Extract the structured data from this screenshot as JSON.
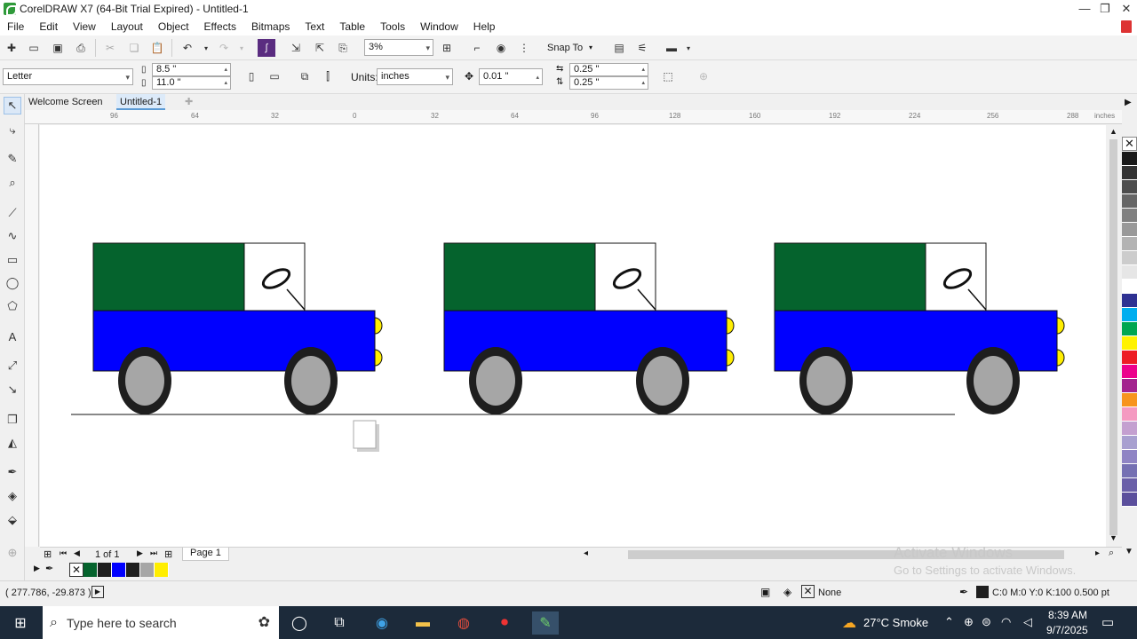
{
  "window": {
    "title": "CorelDRAW X7 (64-Bit Trial Expired) - Untitled-1",
    "minimize": "—",
    "restore": "❐",
    "close": "✕"
  },
  "menu": [
    "File",
    "Edit",
    "View",
    "Layout",
    "Object",
    "Effects",
    "Bitmaps",
    "Text",
    "Table",
    "Tools",
    "Window",
    "Help"
  ],
  "toolbar": {
    "zoom": "3%",
    "snap_to": "Snap To"
  },
  "property_bar": {
    "page_size": "Letter",
    "width": "8.5 \"",
    "height": "11.0 \"",
    "units_label": "Units:",
    "units": "inches",
    "nudge": "0.01 \"",
    "dup_x": "0.25 \"",
    "dup_y": "0.25 \""
  },
  "tabs": [
    "Welcome Screen",
    "Untitled-1"
  ],
  "ruler": {
    "ticks": [
      "96",
      "64",
      "32",
      "0",
      "32",
      "64",
      "96",
      "128",
      "160",
      "192",
      "224",
      "256",
      "288"
    ],
    "unit": "inches"
  },
  "drawing": {
    "trucks": 3,
    "cab_color": "#05632d",
    "body_color": "#0000ff",
    "light_color": "#ffee00",
    "wheel_rim": "#1e1e1e",
    "hub_color": "#a6a6a6"
  },
  "page_nav": {
    "counter": "1 of 1",
    "page_tab": "Page 1"
  },
  "document_palette": [
    "#05632d",
    "#1e1e1e",
    "#0000ff",
    "#1e1e1e",
    "#a6a6a6",
    "#ffee00"
  ],
  "palette": [
    "#1a1a1a",
    "#333333",
    "#4d4d4d",
    "#666666",
    "#808080",
    "#999999",
    "#b3b3b3",
    "#cccccc",
    "#e6e6e6",
    "#ffffff",
    "#2e3192",
    "#00aeef",
    "#00a651",
    "#fff200",
    "#ed1c24",
    "#ec008c",
    "#a3238e",
    "#f7941d",
    "#f49ac1",
    "#c4a0d0",
    "#a8a0d0",
    "#8f84c4",
    "#7570b3",
    "#6a5fa8",
    "#5b4f9c"
  ],
  "status": {
    "coords": "( 277.786, -29.873 )",
    "fill": "None",
    "outline": "C:0 M:0 Y:0 K:100  0.500 pt"
  },
  "watermark": {
    "line1": "Activate Windows",
    "line2": "Go to Settings to activate Windows."
  },
  "taskbar": {
    "search": "Type here to search",
    "weather": "27°C  Smoke",
    "time": "8:39 AM",
    "date": "9/7/2025"
  }
}
